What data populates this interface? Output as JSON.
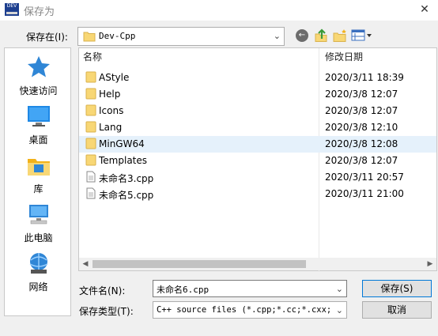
{
  "window": {
    "title": "保存为",
    "app_icon_text": "DEV"
  },
  "toolbar": {
    "save_in_label": "保存在(I):",
    "save_in_value": "Dev-Cpp"
  },
  "places": [
    {
      "label": "快速访问",
      "icon": "quick-access-star-icon"
    },
    {
      "label": "桌面",
      "icon": "desktop-icon"
    },
    {
      "label": "库",
      "icon": "library-icon"
    },
    {
      "label": "此电脑",
      "icon": "this-pc-icon"
    },
    {
      "label": "网络",
      "icon": "network-icon"
    }
  ],
  "list": {
    "columns": {
      "name": "名称",
      "modified": "修改日期"
    },
    "rows": [
      {
        "name": "AStyle",
        "date": "2020/3/11 18:39",
        "type": "folder"
      },
      {
        "name": "Help",
        "date": "2020/3/8 12:07",
        "type": "folder"
      },
      {
        "name": "Icons",
        "date": "2020/3/8 12:07",
        "type": "folder"
      },
      {
        "name": "Lang",
        "date": "2020/3/8 12:10",
        "type": "folder"
      },
      {
        "name": "MinGW64",
        "date": "2020/3/8 12:08",
        "type": "folder"
      },
      {
        "name": "Templates",
        "date": "2020/3/8 12:07",
        "type": "folder"
      },
      {
        "name": "未命名3.cpp",
        "date": "2020/3/11 20:57",
        "type": "file"
      },
      {
        "name": "未命名5.cpp",
        "date": "2020/3/11 21:00",
        "type": "file"
      }
    ],
    "selected_index": 4
  },
  "form": {
    "filename_label": "文件名(N):",
    "filename_value": "未命名6.cpp",
    "filetype_label": "保存类型(T):",
    "filetype_value": "C++ source files (*.cpp;*.cc;*.cxx;*.c++;*.hpp;*.hh)"
  },
  "buttons": {
    "save": "保存(S)",
    "cancel": "取消"
  },
  "colors": {
    "accent": "#0078d7",
    "selection": "#e5f1fb",
    "folder": "#f8d775",
    "annotation": "#e8202a"
  }
}
